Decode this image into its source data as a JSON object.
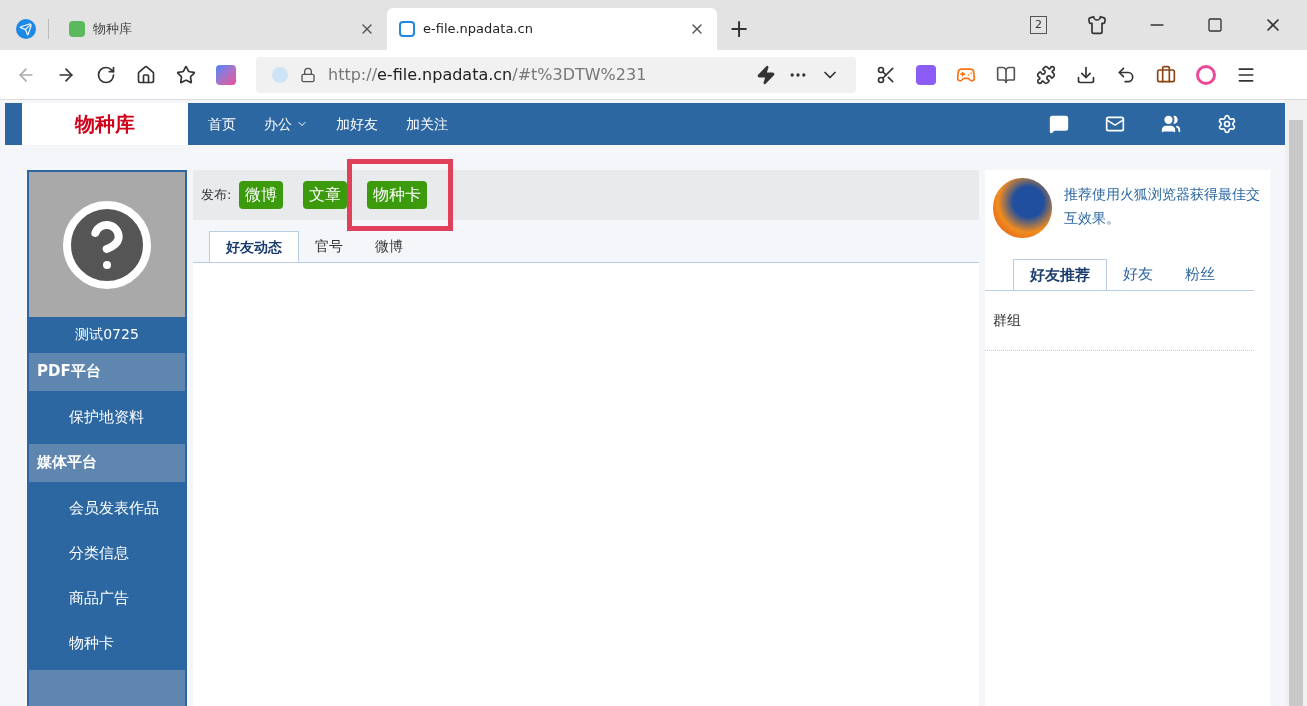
{
  "browser": {
    "tabs": [
      {
        "title": "物种库",
        "selected": false
      },
      {
        "title": "e-file.npadata.cn",
        "selected": true
      }
    ],
    "new_tab": "+",
    "window_count": "2",
    "address": {
      "host": "e-file.npadata.cn",
      "path": "/#t%3DTW%231",
      "scheme": "http://"
    }
  },
  "site": {
    "logo": "物种库",
    "nav": [
      {
        "label": "首页",
        "dropdown": false
      },
      {
        "label": "办公",
        "dropdown": true
      },
      {
        "label": "加好友",
        "dropdown": false
      },
      {
        "label": "加关注",
        "dropdown": false
      }
    ]
  },
  "user": {
    "name": "测试0725"
  },
  "sidebar": [
    {
      "title": "PDF平台",
      "items": [
        "保护地资料"
      ]
    },
    {
      "title": "媒体平台",
      "items": [
        "会员发表作品",
        "分类信息",
        "商品广告",
        "物种卡"
      ]
    }
  ],
  "publish": {
    "label": "发布:",
    "buttons": [
      {
        "label": "微博",
        "highlighted": false
      },
      {
        "label": "文章",
        "highlighted": false
      },
      {
        "label": "物种卡",
        "highlighted": true
      }
    ]
  },
  "feed_tabs": [
    {
      "label": "好友动态",
      "selected": true
    },
    {
      "label": "官号",
      "selected": false
    },
    {
      "label": "微博",
      "selected": false
    }
  ],
  "right": {
    "notice": "推荐使用火狐浏览器获得最佳交互效果。",
    "tabs": [
      {
        "label": "好友推荐",
        "selected": true
      },
      {
        "label": "好友",
        "selected": false
      },
      {
        "label": "粉丝",
        "selected": false
      }
    ],
    "group_label": "群组"
  }
}
